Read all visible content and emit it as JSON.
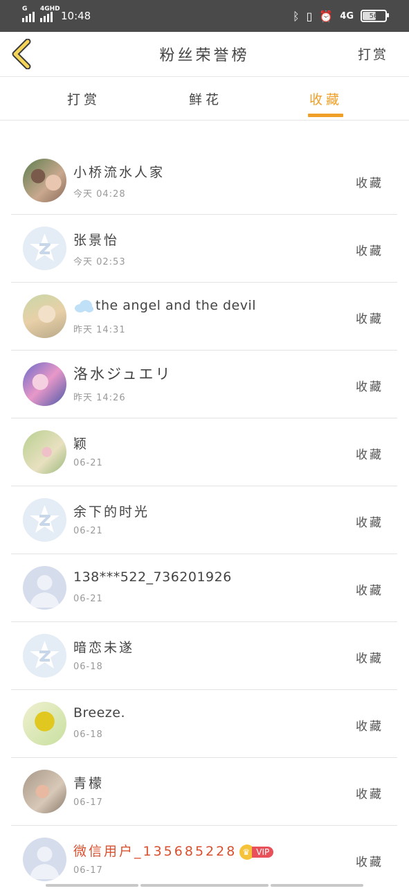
{
  "status_bar": {
    "signal_label_1": "G",
    "signal_label_2": "4GHD",
    "time": "10:48",
    "network": "4G",
    "battery": "56"
  },
  "header": {
    "title": "粉丝荣誉榜",
    "action": "打赏",
    "back_icon": "chevron-left-icon"
  },
  "tabs": [
    {
      "label": "打赏",
      "active": false
    },
    {
      "label": "鲜花",
      "active": false
    },
    {
      "label": "收藏",
      "active": true
    }
  ],
  "accent_color": "#f0a028",
  "list": [
    {
      "name": "小桥流水人家",
      "time": "今天 04:28",
      "action": "收藏",
      "avatar": "photo"
    },
    {
      "name": "张景怡",
      "time": "今天 02:53",
      "action": "收藏",
      "avatar": "qzone-default"
    },
    {
      "name": "the angel and the devil",
      "time": "昨天 14:31",
      "action": "收藏",
      "avatar": "photo"
    },
    {
      "name": "洛水ジュエリ",
      "time": "昨天 14:26",
      "action": "收藏",
      "avatar": "photo"
    },
    {
      "name": "颖",
      "time": "06-21",
      "action": "收藏",
      "avatar": "photo"
    },
    {
      "name": "余下的时光",
      "time": "06-21",
      "action": "收藏",
      "avatar": "qzone-default"
    },
    {
      "name": "138***522_736201926",
      "time": "06-21",
      "action": "收藏",
      "avatar": "person-default"
    },
    {
      "name": "暗恋未遂",
      "time": "06-18",
      "action": "收藏",
      "avatar": "qzone-default"
    },
    {
      "name": "Breeze.",
      "time": "06-18",
      "action": "收藏",
      "avatar": "photo"
    },
    {
      "name": "青檬",
      "time": "06-17",
      "action": "收藏",
      "avatar": "photo"
    },
    {
      "name": "微信用户_135685228",
      "time": "06-17",
      "action": "收藏",
      "avatar": "person-default",
      "badge": "VIP"
    }
  ]
}
